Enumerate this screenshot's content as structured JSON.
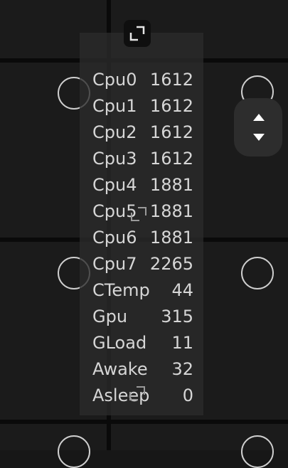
{
  "stats": [
    {
      "label": "Cpu0",
      "value": "1612"
    },
    {
      "label": "Cpu1",
      "value": "1612"
    },
    {
      "label": "Cpu2",
      "value": "1612"
    },
    {
      "label": "Cpu3",
      "value": "1612"
    },
    {
      "label": "Cpu4",
      "value": "1881"
    },
    {
      "label": "Cpu5",
      "value": "1881"
    },
    {
      "label": "Cpu6",
      "value": "1881"
    },
    {
      "label": "Cpu7",
      "value": "2265"
    },
    {
      "label": "CTemp",
      "value": "44"
    },
    {
      "label": "Gpu",
      "value": "315"
    },
    {
      "label": "GLoad",
      "value": "11"
    },
    {
      "label": "Awake",
      "value": "32"
    },
    {
      "label": "Asleep",
      "value": "0"
    }
  ],
  "icons": {
    "expand": "expand-icon",
    "resize_middle": "resize-corner-icon",
    "resize_bottom": "resize-corner-icon",
    "stepper_up": "arrow-up-icon",
    "stepper_down": "arrow-down-icon"
  },
  "colors": {
    "background": "#171717",
    "overlay": "#2a2a2a",
    "text": "#d6d6d6",
    "accent": "#ffffff"
  }
}
